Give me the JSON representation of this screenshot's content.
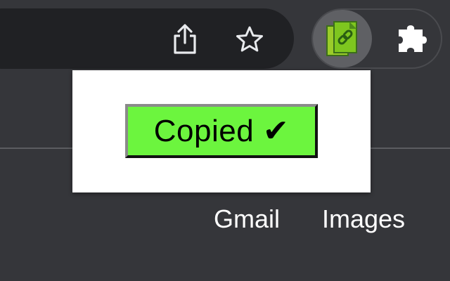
{
  "toolbar": {
    "share_icon": "share-icon",
    "bookmark_icon": "star-outline-icon"
  },
  "extensions": {
    "active_extension_icon": "link-copy-extension-icon",
    "extensions_menu_icon": "puzzle-piece-icon",
    "active_color": "#5f6064"
  },
  "popup": {
    "message": "Copied ✔",
    "box_color": "#6cf53e"
  },
  "page_links": {
    "gmail": "Gmail",
    "images": "Images"
  },
  "colors": {
    "toolbar_bg": "#35363a",
    "omnibox_bg": "#202124",
    "link_text": "#ffffff"
  }
}
